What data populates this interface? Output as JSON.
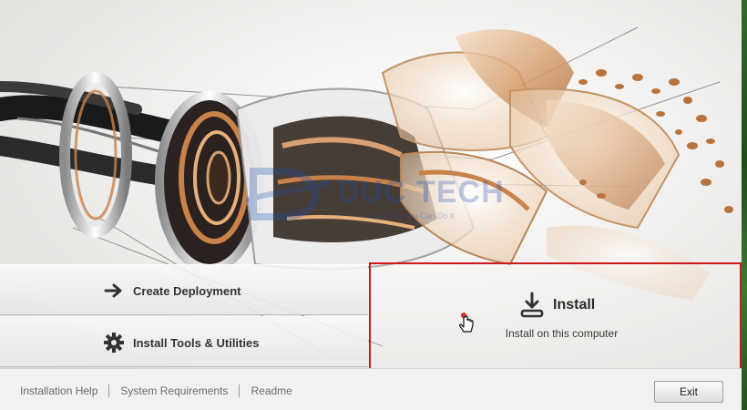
{
  "options": {
    "create_deployment": "Create Deployment",
    "install_tools": "Install Tools & Utilities"
  },
  "install": {
    "title": "Install",
    "subtitle": "Install on this computer"
  },
  "watermark": {
    "name": "DUC TECH",
    "slogan": "I Can Do It You Can Do It"
  },
  "footer": {
    "links": [
      "Installation Help",
      "System Requirements",
      "Readme"
    ],
    "exit_label": "Exit"
  },
  "icons": {
    "deploy": "arrow-right-icon",
    "tools": "gear-icon",
    "install": "download-tray-icon"
  },
  "colors": {
    "highlight_border": "#d0191e",
    "accent_copper": "#c8824a"
  }
}
